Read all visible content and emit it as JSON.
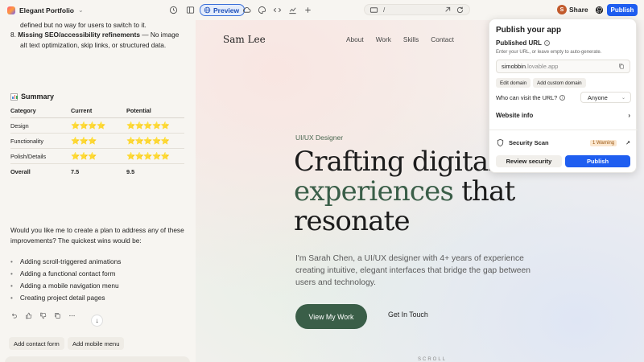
{
  "topbar": {
    "project_name": "Elegant Portfolio",
    "preview_label": "Preview",
    "address_path": "/",
    "avatar_initial": "S",
    "share_label": "Share",
    "publish_label": "Publish",
    "accent_color": "#1f5ef0"
  },
  "chat": {
    "outline_continued": "defined but no way for users to switch to it.",
    "item8_number": "8.",
    "item8_bold": "Missing SEO/accessibility refinements",
    "item8_rest": " — No image",
    "item8_line2": "alt text optimization, skip links, or structured data.",
    "summary_title": "Summary",
    "table": {
      "headers": [
        "Category",
        "Current",
        "Potential"
      ],
      "rows": [
        {
          "category": "Design",
          "current": "⭐⭐⭐⭐",
          "potential": "⭐⭐⭐⭐⭐"
        },
        {
          "category": "Functionality",
          "current": "⭐⭐⭐",
          "potential": "⭐⭐⭐⭐⭐"
        },
        {
          "category": "Polish/Details",
          "current": "⭐⭐⭐",
          "potential": "⭐⭐⭐⭐⭐"
        },
        {
          "category": "Overall",
          "current": "7.5",
          "potential": "9.5"
        }
      ]
    },
    "question": "Would you like me to create a plan to address any of these improvements? The quickest wins would be:",
    "quick_wins": [
      "Adding scroll-triggered animations",
      "Adding a functional contact form",
      "Adding a mobile navigation menu",
      "Creating project detail pages"
    ],
    "suggestion_chips": [
      "Add contact form",
      "Add mobile menu"
    ]
  },
  "site": {
    "brand": "Sam Lee",
    "nav": [
      "About",
      "Work",
      "Skills",
      "Contact"
    ],
    "eyebrow": "UI/UX Designer",
    "hero_line1": "Crafting digital",
    "hero_green": "experiences",
    "hero_line2_rest": " that",
    "hero_line3": "resonate",
    "bio": "I'm Sarah Chen, a UI/UX designer with 4+ years of experience creating intuitive, elegant interfaces that bridge the gap between users and technology.",
    "primary_cta": "View My Work",
    "secondary_cta": "Get In Touch",
    "scroll_hint": "SCROLL",
    "green_color": "#3a5e48"
  },
  "publish_panel": {
    "title": "Publish your app",
    "published_url_label": "Published URL",
    "hint": "Enter your URL, or leave empty to auto-generate.",
    "url_slug": "simobbin",
    "url_suffix": ".lovable.app",
    "edit_domain": "Edit domain",
    "add_custom_domain": "Add custom domain",
    "visibility_label": "Who can visit the URL?",
    "visibility_value": "Anyone",
    "website_info": "Website info",
    "security_scan": "Security Scan",
    "warning_badge": "1 Warning",
    "review_security": "Review security",
    "publish": "Publish",
    "warning_color": "#fbe7cf"
  }
}
